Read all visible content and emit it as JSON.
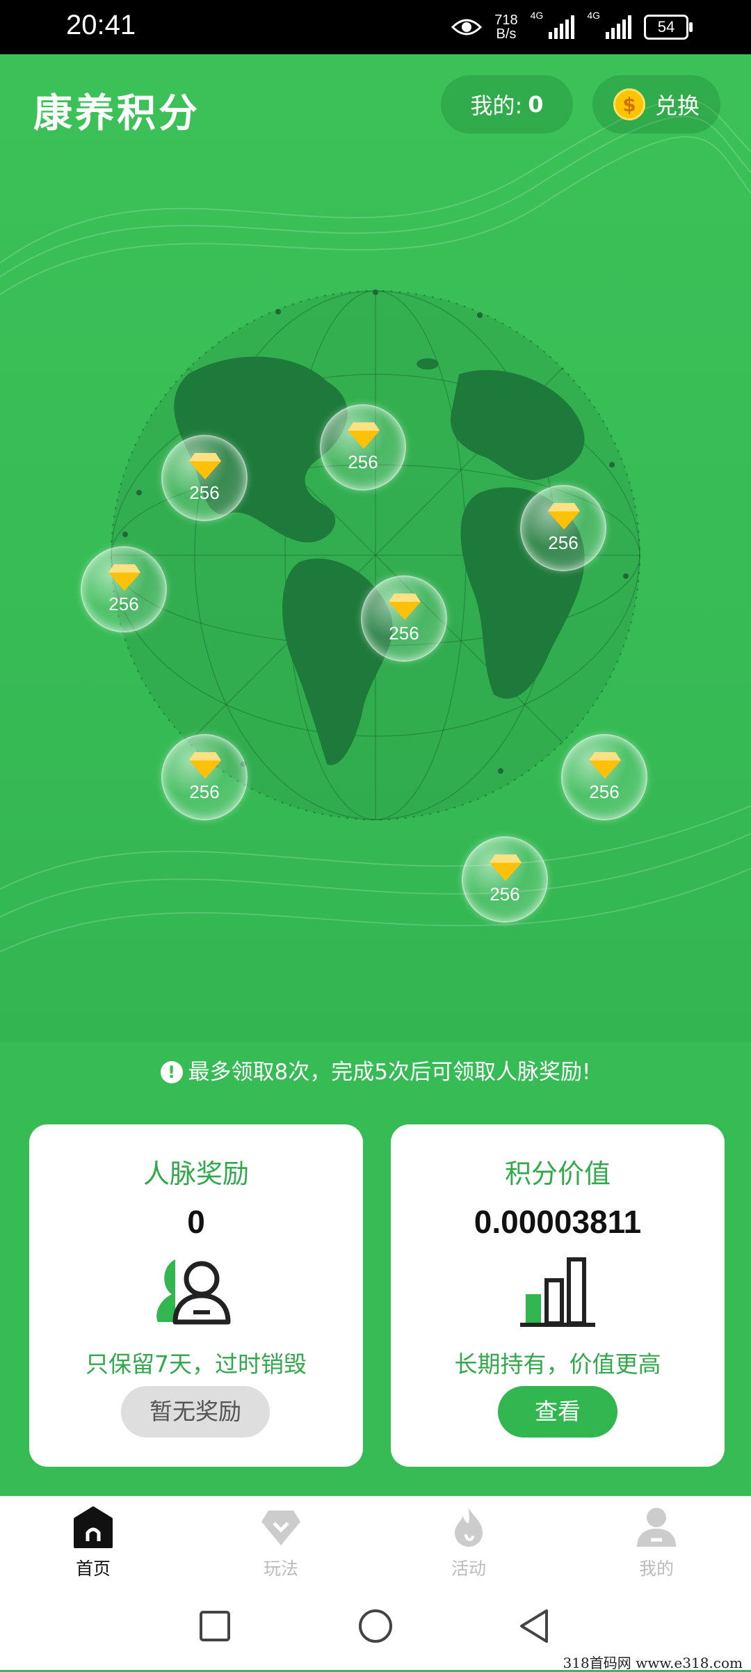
{
  "status_bar": {
    "time": "20:41",
    "net_speed_value": "718",
    "net_speed_unit": "B/s",
    "sim1": "4G",
    "sim2": "4G",
    "battery": "54"
  },
  "header": {
    "title": "康养积分",
    "mine_label": "我的:",
    "mine_value": "0",
    "exchange_label": "兑换",
    "coin_glyph": "$"
  },
  "bubbles": [
    {
      "value": "256"
    },
    {
      "value": "256"
    },
    {
      "value": "256"
    },
    {
      "value": "256"
    },
    {
      "value": "256"
    },
    {
      "value": "256"
    },
    {
      "value": "256"
    },
    {
      "value": "256"
    }
  ],
  "notice": {
    "icon": "!",
    "text": "最多领取8次，完成5次后可领取人脉奖励!"
  },
  "cards": {
    "network": {
      "title": "人脉奖励",
      "value": "0",
      "note": "只保留7天，过时销毁",
      "button": "暂无奖励"
    },
    "points": {
      "title": "积分价值",
      "value": "0.00003811",
      "note": "长期持有，价值更高",
      "button": "查看"
    }
  },
  "tabs": [
    {
      "label": "首页",
      "icon": "home-icon",
      "active": true
    },
    {
      "label": "玩法",
      "icon": "diamond-icon",
      "active": false
    },
    {
      "label": "活动",
      "icon": "flame-icon",
      "active": false
    },
    {
      "label": "我的",
      "icon": "user-icon",
      "active": false
    }
  ],
  "watermark": "318首码网  www.e318.com",
  "colors": {
    "primary": "#36bb55",
    "accent_text": "#32a84c",
    "gem": "#ffc107"
  }
}
